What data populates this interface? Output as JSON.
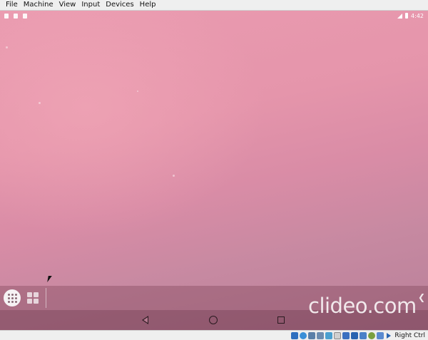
{
  "menubar": {
    "items": [
      "File",
      "Machine",
      "View",
      "Input",
      "Devices",
      "Help"
    ]
  },
  "status_bar": {
    "time": "4:42",
    "notification_icons": [
      "doc-icon",
      "image-icon",
      "sd-card-icon"
    ]
  },
  "navigation": {
    "back": "back-icon",
    "home": "home-icon",
    "overview": "overview-icon"
  },
  "taskbar": {
    "chevron": "❮"
  },
  "watermark": {
    "text": "clideo.com"
  },
  "vbox_status": {
    "host_key": "Right Ctrl",
    "tray_colors": [
      "#2f6fbf",
      "#3a8fd8",
      "#5a7fa8",
      "#6c8cb0",
      "#4aa0d0",
      "#8a8a8a",
      "#3a70c0",
      "#2a64b0",
      "#4a80c8",
      "#7aa040",
      "#5a8ad0",
      "#6a9040"
    ]
  },
  "colors": {
    "wallpaper_top": "#ea9bb0",
    "wallpaper_bottom": "#b98099"
  }
}
